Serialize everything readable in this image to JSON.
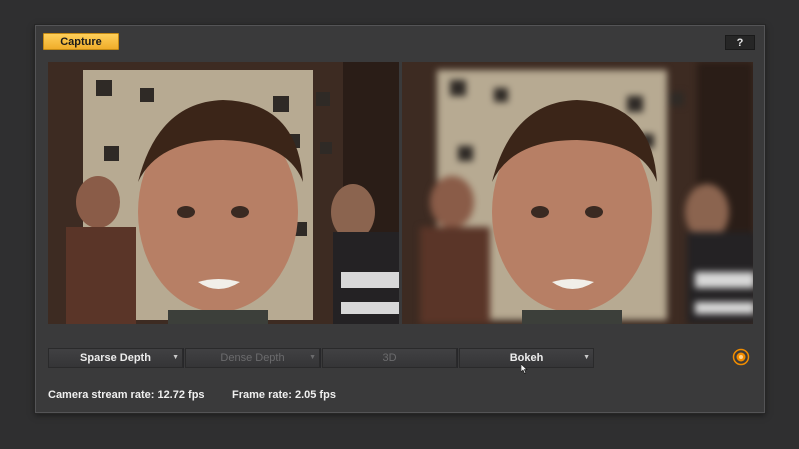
{
  "toolbar": {
    "capture_label": "Capture",
    "help_label": "?"
  },
  "tabs": [
    {
      "label": "Sparse Depth",
      "state": "active",
      "has_menu": true
    },
    {
      "label": "Dense Depth",
      "state": "disabled",
      "has_menu": true
    },
    {
      "label": "3D",
      "state": "disabled",
      "has_menu": false
    },
    {
      "label": "Bokeh",
      "state": "active",
      "has_menu": true
    }
  ],
  "stats": {
    "camera_stream_rate": "Camera stream rate: 12.72 fps",
    "frame_rate": "Frame rate: 2.05 fps"
  },
  "views": {
    "left": "sharp camera feed",
    "right": "bokeh blurred background feed"
  },
  "colors": {
    "capture_button": "#f5b83d",
    "logo_accent": "#f08c00"
  },
  "icons": {
    "logo": "orange-circle-logo-icon",
    "menu_arrow": "triangle-down-icon",
    "cursor": "mouse-pointer-icon"
  }
}
